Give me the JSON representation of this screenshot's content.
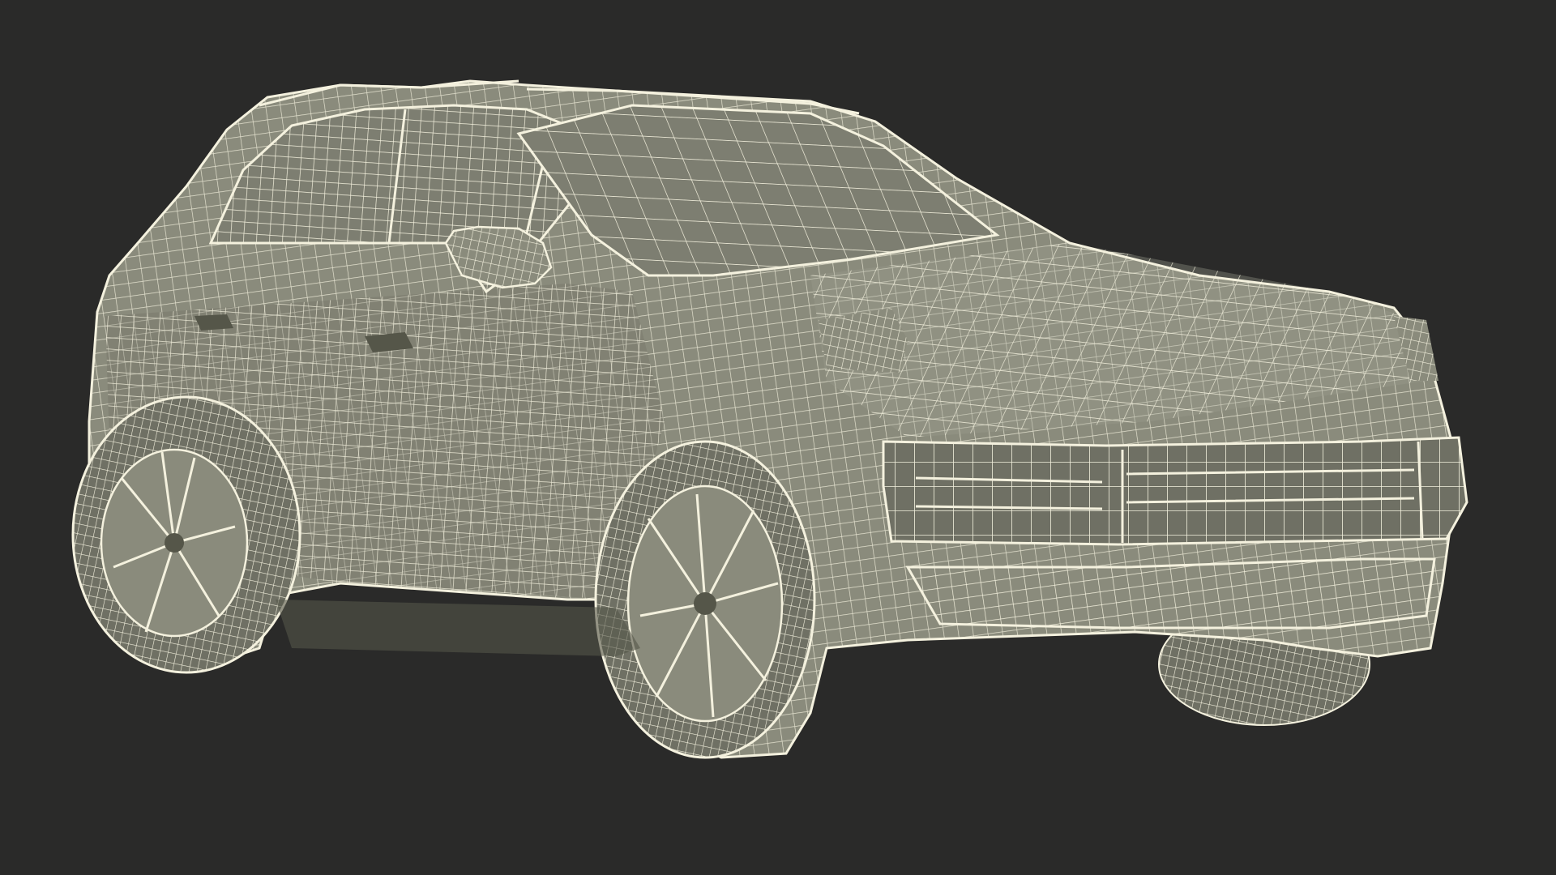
{
  "scene": {
    "subject": "suv-wireframe-model",
    "colors": {
      "background": "#2a2a29",
      "body": "#8a8b7c",
      "body_shadow": "#6f7064",
      "body_highlight": "#9c9d8e",
      "wire": "#f4f1de",
      "glass": "#7d7e71",
      "dark_detail": "#555649"
    }
  }
}
